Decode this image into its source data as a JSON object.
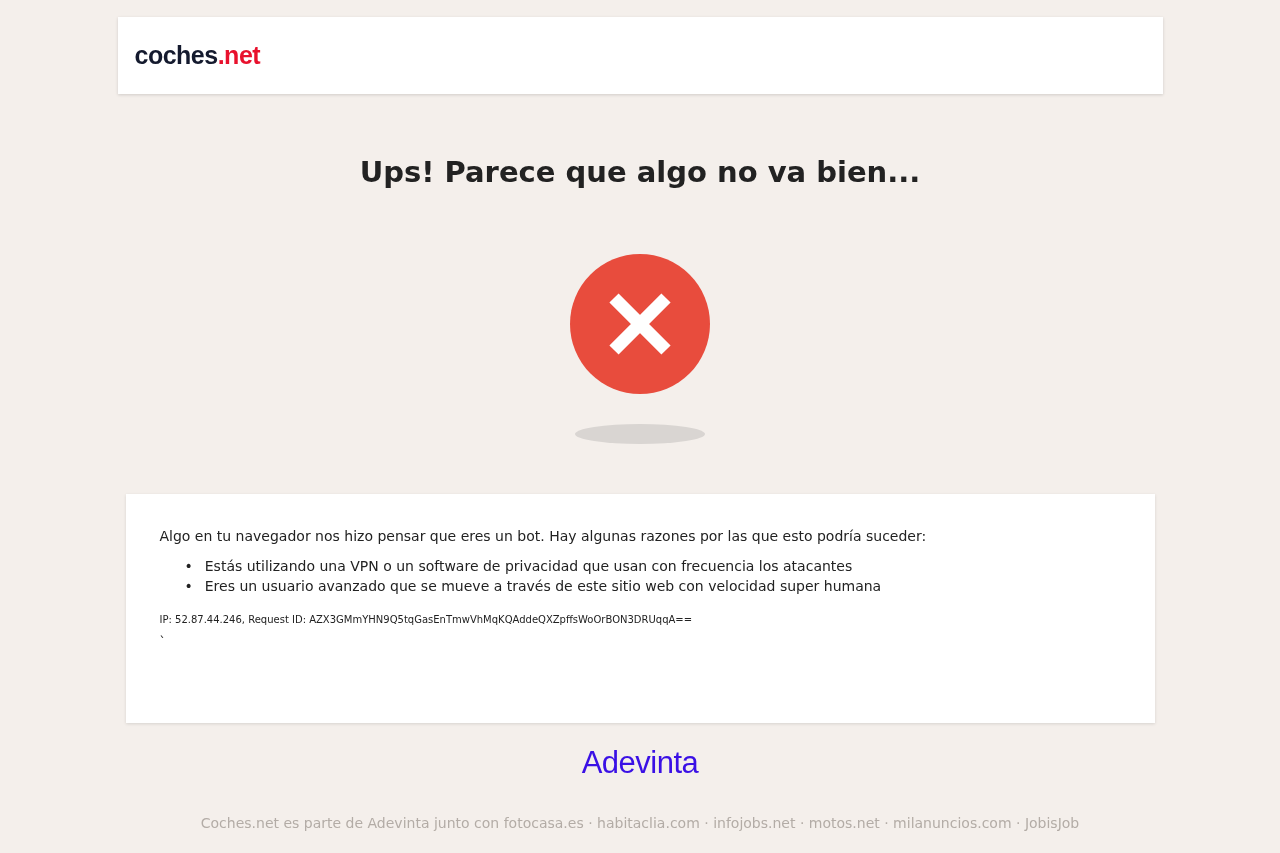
{
  "header": {
    "logo": {
      "dark": "coches",
      "accent": ".net"
    }
  },
  "title": "Ups! Parece que algo no va bien...",
  "message": {
    "intro": "Algo en tu navegador nos hizo pensar que eres un bot. Hay algunas razones por las que esto podría suceder:",
    "reasons": [
      {
        "marker": "•",
        "text": "Estás utilizando una VPN o un software de privacidad que usan con frecuencia los atacantes"
      },
      {
        "marker": "•",
        "text": "Eres un usuario avanzado que se mueve a través de este sitio web con velocidad super humana"
      }
    ],
    "request_info": "IP: 52.87.44.246, Request ID: AZX3GMmYHN9Q5tqGasEnTmwVhMqKQAddeQXZpffsWoOrBON3DRUqqA==",
    "stray_mark": "`"
  },
  "footer": {
    "brand": "Adevinta",
    "note": "Coches.net es parte de Adevinta junto con fotocasa.es · habitaclia.com · infojobs.net · motos.net · milanuncios.com · JobisJob"
  }
}
